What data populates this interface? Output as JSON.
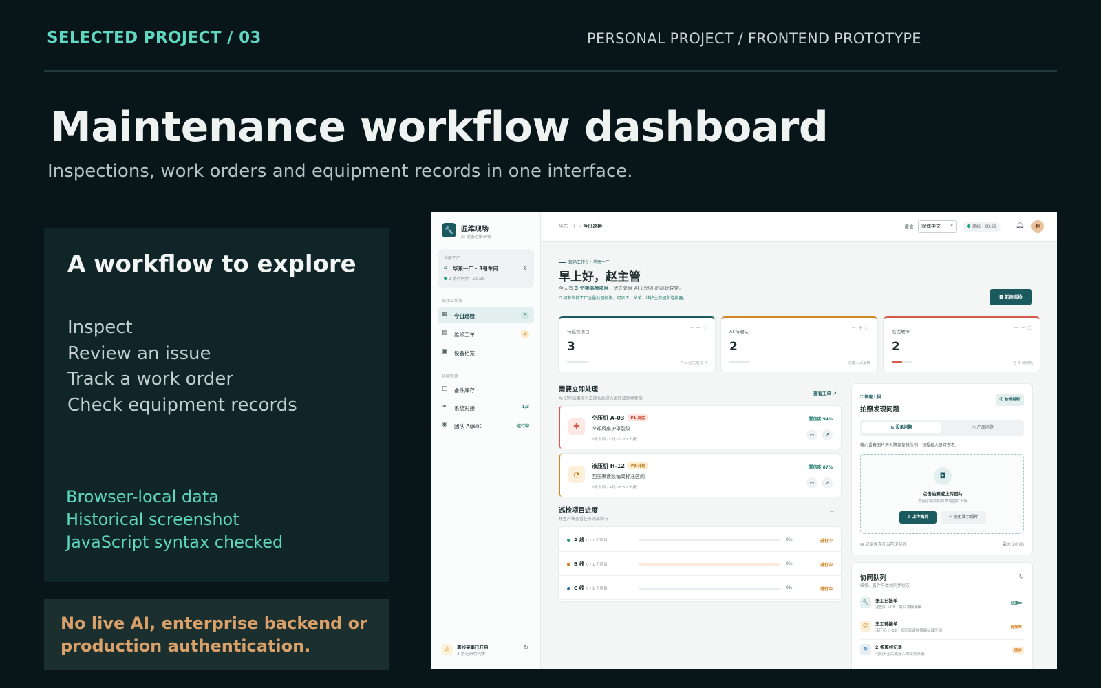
{
  "header": {
    "kicker": "SELECTED PROJECT / 03",
    "kicker_right": "PERSONAL PROJECT / FRONTEND PROTOTYPE",
    "title": "Maintenance workflow dashboard",
    "subtitle": "Inspections, work orders and equipment records in one interface."
  },
  "workflow": {
    "title": "A workflow to explore",
    "steps": [
      "Inspect",
      "Review an issue",
      "Track a work order",
      "Check equipment records"
    ],
    "notes": [
      "Browser-local data",
      "Historical screenshot",
      "JavaScript syntax checked"
    ]
  },
  "warning": {
    "line1": "No live AI, enterprise backend or",
    "line2": "production authentication."
  },
  "app": {
    "brand": "匠维现场",
    "brand_sub": "AI 设备运维平台",
    "factory_label": "当前工厂",
    "factory_name": "华东一厂 · 3号车间",
    "factory_sync": "2 条待同步 · 20:29",
    "section_work": "现场工作台",
    "section_collab": "协同管理",
    "nav": [
      {
        "label": "今日巡检",
        "badge": "3"
      },
      {
        "label": "维修工单",
        "badge": "2"
      },
      {
        "label": "设备档案"
      },
      {
        "label": "备件库存"
      },
      {
        "label": "系统对接",
        "badge": "1/3"
      },
      {
        "label": "团队 Agent",
        "badge": "运行中"
      }
    ],
    "sync_title": "离线采集已开启",
    "sync_sub": "2 条记录待同步",
    "breadcrumb_parent": "华东一厂",
    "breadcrumb_current": "今日巡检",
    "lang_label": "语言",
    "lang_value": "简体中文",
    "online": "离线 · 20:29",
    "avatar": "赵",
    "context": "现场工作台 · 华东一厂",
    "greeting": "早上好，赵主管",
    "greeting_sub_pre": "今天有",
    "greeting_sub_bold": "3 个待巡检项目",
    "greeting_sub_post": "，优先处理 AI 识别出的高优异常。",
    "permission": "拥有当前工厂全量处理权限，可派工、关单、维护主数据和连接器。",
    "new_button": "新建巡检",
    "kpis": [
      {
        "label": "待巡检项目",
        "value": "3",
        "footer": "今日已完成 0 个",
        "color": "#1b5a5e",
        "fill": 0.0
      },
      {
        "label": "AI 待确认",
        "value": "2",
        "footer": "需要人工复核",
        "color": "#d08a2a",
        "fill": 0.0
      },
      {
        "label": "高优故障",
        "value": "2",
        "footer": "含 4 台停机",
        "color": "#d45a4a",
        "fill": 0.5
      }
    ],
    "urgent_title": "需要立即处理",
    "urgent_sub": "AI 识别结果需人工确认后进入维修或质量复检",
    "urgent_link": "查看工单",
    "tasks": [
      {
        "name": "空压机 A-03",
        "tag": "P1 高优",
        "desc": "冷却风扇护罩裂纹",
        "meta": "3号车间 · C线   09:28 上报",
        "conf": "置信度 94%"
      },
      {
        "name": "液压机 H-12",
        "tag": "P2 计划",
        "desc": "回压表读数偏离标准区间",
        "meta": "3号车间 · A线   08:56 上报",
        "conf": "置信度 87%"
      }
    ],
    "progress_title": "巡检项目进度",
    "progress_sub": "按生产线查看任务完成情况",
    "lines": [
      {
        "name": "A 线",
        "count": "0 / 1 个项目",
        "pct": "0%",
        "status": "进行中",
        "color": "#21a07a",
        "track": "#e6efed"
      },
      {
        "name": "B 线",
        "count": "0 / 1 个项目",
        "pct": "0%",
        "status": "进行中",
        "color": "#d08a2a",
        "track": "#fbeadb"
      },
      {
        "name": "C 线",
        "count": "0 / 1 个项目",
        "pct": "0%",
        "status": "进行中",
        "color": "#2f6fb3",
        "track": "#e6edf3"
      }
    ],
    "quick_label": "快速上报",
    "quick_title": "拍照发现问题",
    "quick_badge": "检修指南",
    "tab_equipment": "设备问题",
    "tab_product": "产品问题",
    "quick_desc": "核心设备图片进入隔离复核队列，仅授权人员可查看。",
    "drop_title": "点击拍照或上传图片",
    "drop_sub": "支持手机相机与本地图片上传",
    "upload_btn": "上传图片",
    "demo_btn": "使用演示照片",
    "storage_note": "记录保存在当前浏览器",
    "max_size": "最大 20MB",
    "queue_title": "协同队列",
    "queue_sub": "维修、备件与本地同步状态",
    "queue": [
      {
        "t1": "张工已接单",
        "t2": "注塑机 I-08 · 最后顶模漏模",
        "st": "处理中"
      },
      {
        "t1": "王工待接单",
        "t2": "液压机 H-12 · 回压表读数偏离标准区间",
        "st": "待接单"
      },
      {
        "t1": "2 条离线记录",
        "t2": "可同步至后端接入的业务系统",
        "st": "同步"
      }
    ]
  }
}
